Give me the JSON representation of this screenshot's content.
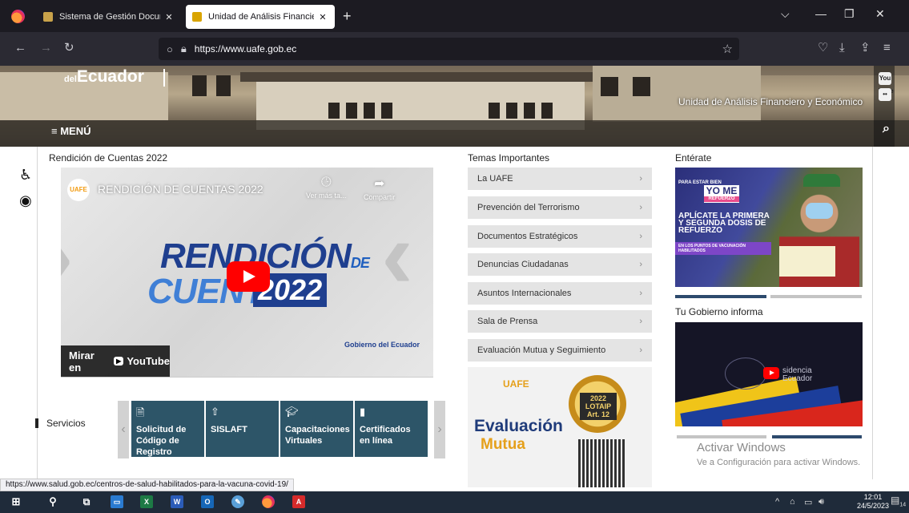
{
  "browser": {
    "tabs": [
      {
        "label": "Sistema de Gestión Documenta",
        "active": false
      },
      {
        "label": "Unidad de Análisis Financiero y",
        "active": true
      }
    ],
    "url": "https://www.uafe.gob.ec",
    "status_url": "https://www.salud.gob.ec/centros-de-salud-habilitados-para-la-vacuna-covid-19/"
  },
  "header": {
    "brand_prefix": "del",
    "brand": "Ecuador",
    "unit_name": "Unidad de Análisis Financiero y Económico",
    "menu_label": "≡ MENÚ",
    "social_youtube": "You Tube",
    "social_flickr": "••"
  },
  "rendicion": {
    "heading": "Rendición de Cuentas 2022",
    "video": {
      "channel_logo": "UAFE",
      "title": "RENDICIÓN DE CUENTAS 2022",
      "watch_later": "Ver más ta...",
      "share": "Compartir",
      "art_line1": "RENDICIÓN",
      "art_de": "DE",
      "art_line2": "CUENTAS",
      "art_year": "2022",
      "gob_label": "Gobierno del Ecuador",
      "watch_on": "Mirar en",
      "youtube": "YouTube"
    }
  },
  "services": {
    "label": "Servicios",
    "items": [
      {
        "icon": "document-icon",
        "label": "Solicitud de Código de Registro"
      },
      {
        "icon": "upload-icon",
        "label": "SISLAFT"
      },
      {
        "icon": "graduation-cap-icon",
        "label": "Capacitaciones Virtuales"
      },
      {
        "icon": "certificate-icon",
        "label": "Certificados en línea"
      }
    ]
  },
  "temas": {
    "heading": "Temas Importantes",
    "items": [
      "La UAFE",
      "Prevención del Terrorismo",
      "Documentos Estratégicos",
      "Denuncias Ciudadanas",
      "Asuntos Internacionales",
      "Sala de Prensa",
      "Evaluación Mutua y Seguimiento"
    ],
    "arrow": "›"
  },
  "banner": {
    "uafe": "UAFE",
    "line1": "Evaluación",
    "line2": "Mutua",
    "seal": "2022 LOTAIP Art. 12"
  },
  "enterate": {
    "heading": "Entérate",
    "poster_top": "PARA ESTAR BIEN",
    "poster_yo": "YO ME",
    "poster_ref": "REFUERZO",
    "poster_main": "APLÍCATE LA PRIMERA Y SEGUNDA DOSIS DE REFUERZO",
    "poster_bottom": "EN LOS PUNTOS DE VACUNACIÓN HABILITADOS"
  },
  "gobierno": {
    "heading": "Tu Gobierno informa",
    "video_text": "sidencia Ecuador"
  },
  "windows": {
    "activate_title": "Activar Windows",
    "activate_sub": "Ve a Configuración para activar Windows.",
    "time": "12:01",
    "date": "24/5/2023",
    "notifications": "14"
  }
}
